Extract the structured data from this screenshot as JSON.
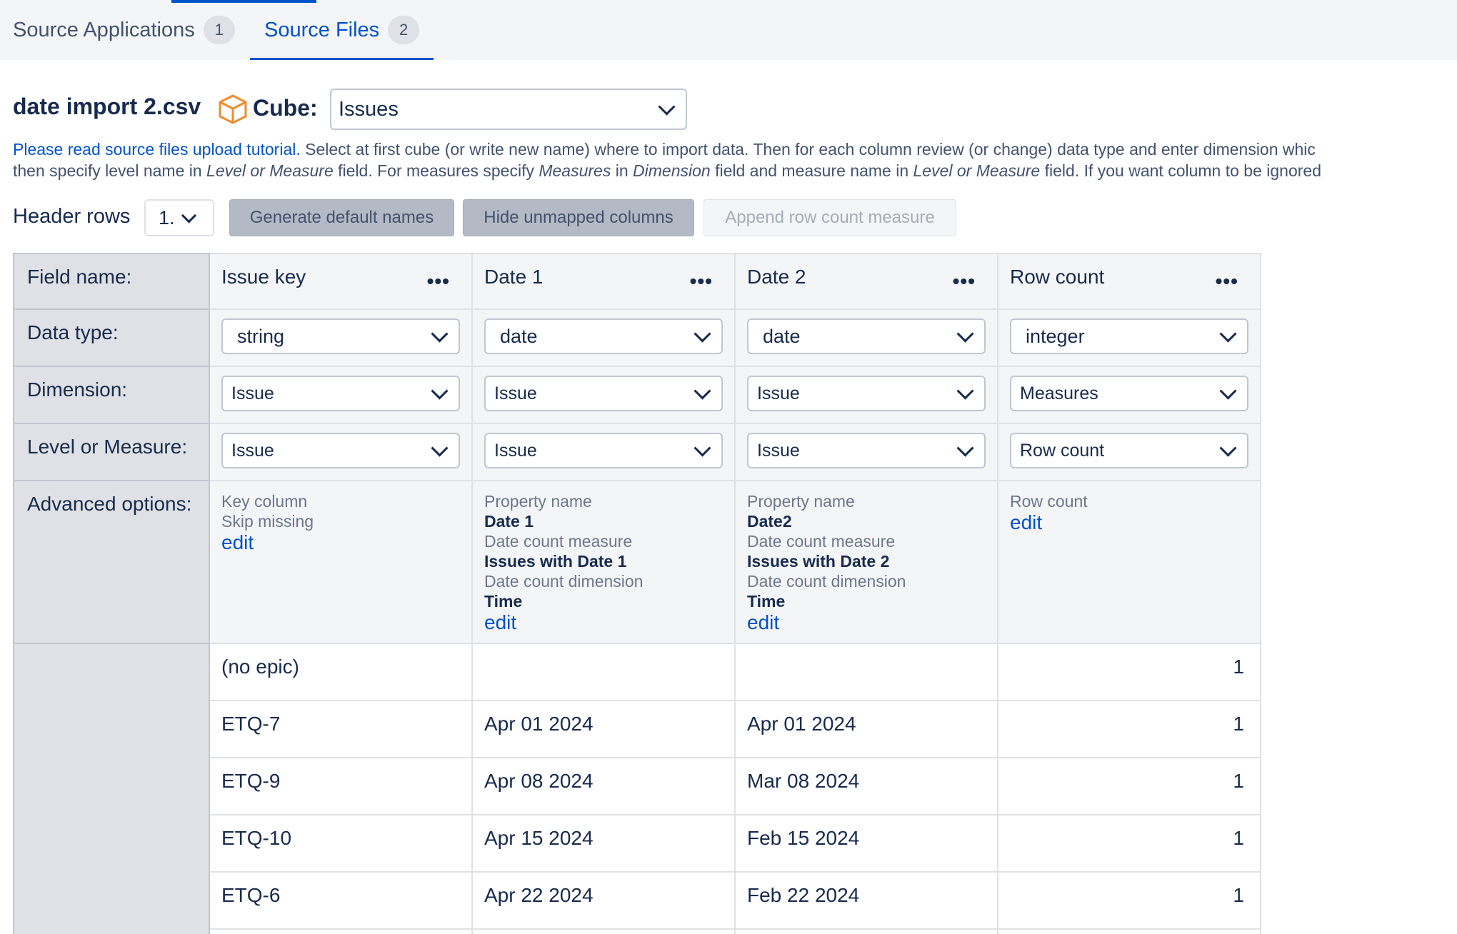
{
  "tabs": [
    {
      "label": "Source Applications",
      "count": "1"
    },
    {
      "label": "Source Files",
      "count": "2"
    }
  ],
  "file": {
    "name": "date import 2.csv",
    "cube_label": "Cube:",
    "cube_value": "Issues"
  },
  "help": {
    "link": "Please read source files upload tutorial.",
    "line1_rest": " Select at first cube (or write new name) where to import data. Then for each column review (or change) data type and enter dimension whic",
    "line2_a": "then specify level name in ",
    "line2_b": "Level or Measure",
    "line2_c": " field. For measures specify ",
    "line2_d": "Measures",
    "line2_e": " in ",
    "line2_f": "Dimension",
    "line2_g": " field and measure name in ",
    "line2_h": "Level or Measure",
    "line2_i": " field. If you want column to be ignored"
  },
  "toolbar": {
    "header_rows_label": "Header rows",
    "header_rows_value": "1.",
    "generate": "Generate default names",
    "hide": "Hide unmapped columns",
    "append": "Append row count measure"
  },
  "row_labels": {
    "field_name": "Field name:",
    "data_type": "Data type:",
    "dimension": "Dimension:",
    "level": "Level or Measure:",
    "advanced": "Advanced options:"
  },
  "columns": [
    {
      "field": "Issue key",
      "type": "string",
      "dimension": "Issue",
      "level": "Issue",
      "adv_l1": "Key column",
      "adv_l2": "Skip missing",
      "edit": "edit"
    },
    {
      "field": "Date 1",
      "type": "date",
      "dimension": "Issue",
      "level": "Issue",
      "adv_p_label": "Property name",
      "adv_p": "Date 1",
      "adv_m_label": "Date count measure",
      "adv_m": "Issues with Date 1",
      "adv_d_label": "Date count dimension",
      "adv_d": "Time",
      "edit": "edit"
    },
    {
      "field": "Date 2",
      "type": "date",
      "dimension": "Issue",
      "level": "Issue",
      "adv_p_label": "Property name",
      "adv_p": "Date2",
      "adv_m_label": "Date count measure",
      "adv_m": "Issues with Date 2",
      "adv_d_label": "Date count dimension",
      "adv_d": "Time",
      "edit": "edit"
    },
    {
      "field": "Row count",
      "type": "integer",
      "dimension": "Measures",
      "level": "Row count",
      "adv_l1": "Row count",
      "edit": "edit"
    }
  ],
  "more_glyph": "•••",
  "rows": [
    {
      "key": "(no epic)",
      "date1": "",
      "date2": "",
      "count": "1"
    },
    {
      "key": "ETQ-7",
      "date1": "Apr 01 2024",
      "date2": "Apr 01 2024",
      "count": "1"
    },
    {
      "key": "ETQ-9",
      "date1": "Apr 08 2024",
      "date2": "Mar 08 2024",
      "count": "1"
    },
    {
      "key": "ETQ-10",
      "date1": "Apr 15 2024",
      "date2": "Feb 15 2024",
      "count": "1"
    },
    {
      "key": "ETQ-6",
      "date1": "Apr 22 2024",
      "date2": "Feb 22 2024",
      "count": "1"
    }
  ]
}
